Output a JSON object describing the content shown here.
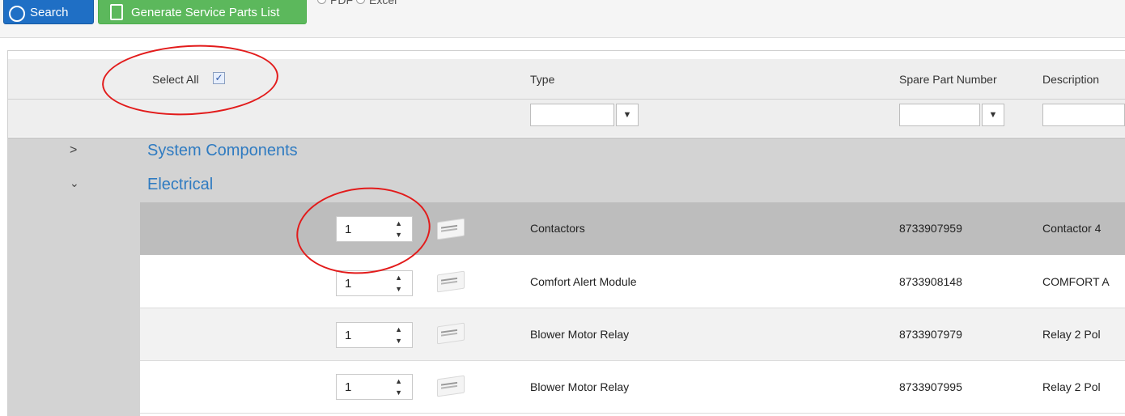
{
  "toolbar": {
    "search_label": "Search",
    "generate_label": "Generate Service Parts List",
    "format_options": [
      "PDF",
      "Excel"
    ]
  },
  "grid": {
    "select_all_label": "Select All",
    "columns": [
      "Type",
      "Spare Part Number",
      "Description"
    ],
    "groups": [
      {
        "label": "System Components",
        "expanded": false
      },
      {
        "label": "Electrical",
        "expanded": true
      }
    ],
    "rows": [
      {
        "qty": "1",
        "type": "Contactors",
        "part_number": "8733907959",
        "description": "Contactor 4"
      },
      {
        "qty": "1",
        "type": "Comfort Alert Module",
        "part_number": "8733908148",
        "description": "COMFORT A"
      },
      {
        "qty": "1",
        "type": "Blower Motor Relay",
        "part_number": "8733907979",
        "description": "Relay 2 Pol"
      },
      {
        "qty": "1",
        "type": "Blower Motor Relay",
        "part_number": "8733907995",
        "description": "Relay 2 Pol"
      }
    ]
  },
  "colors": {
    "search_button": "#1f6fc5",
    "generate_button": "#5cb85c",
    "group_link": "#2f7bc1",
    "annotation": "#e21b1b"
  }
}
